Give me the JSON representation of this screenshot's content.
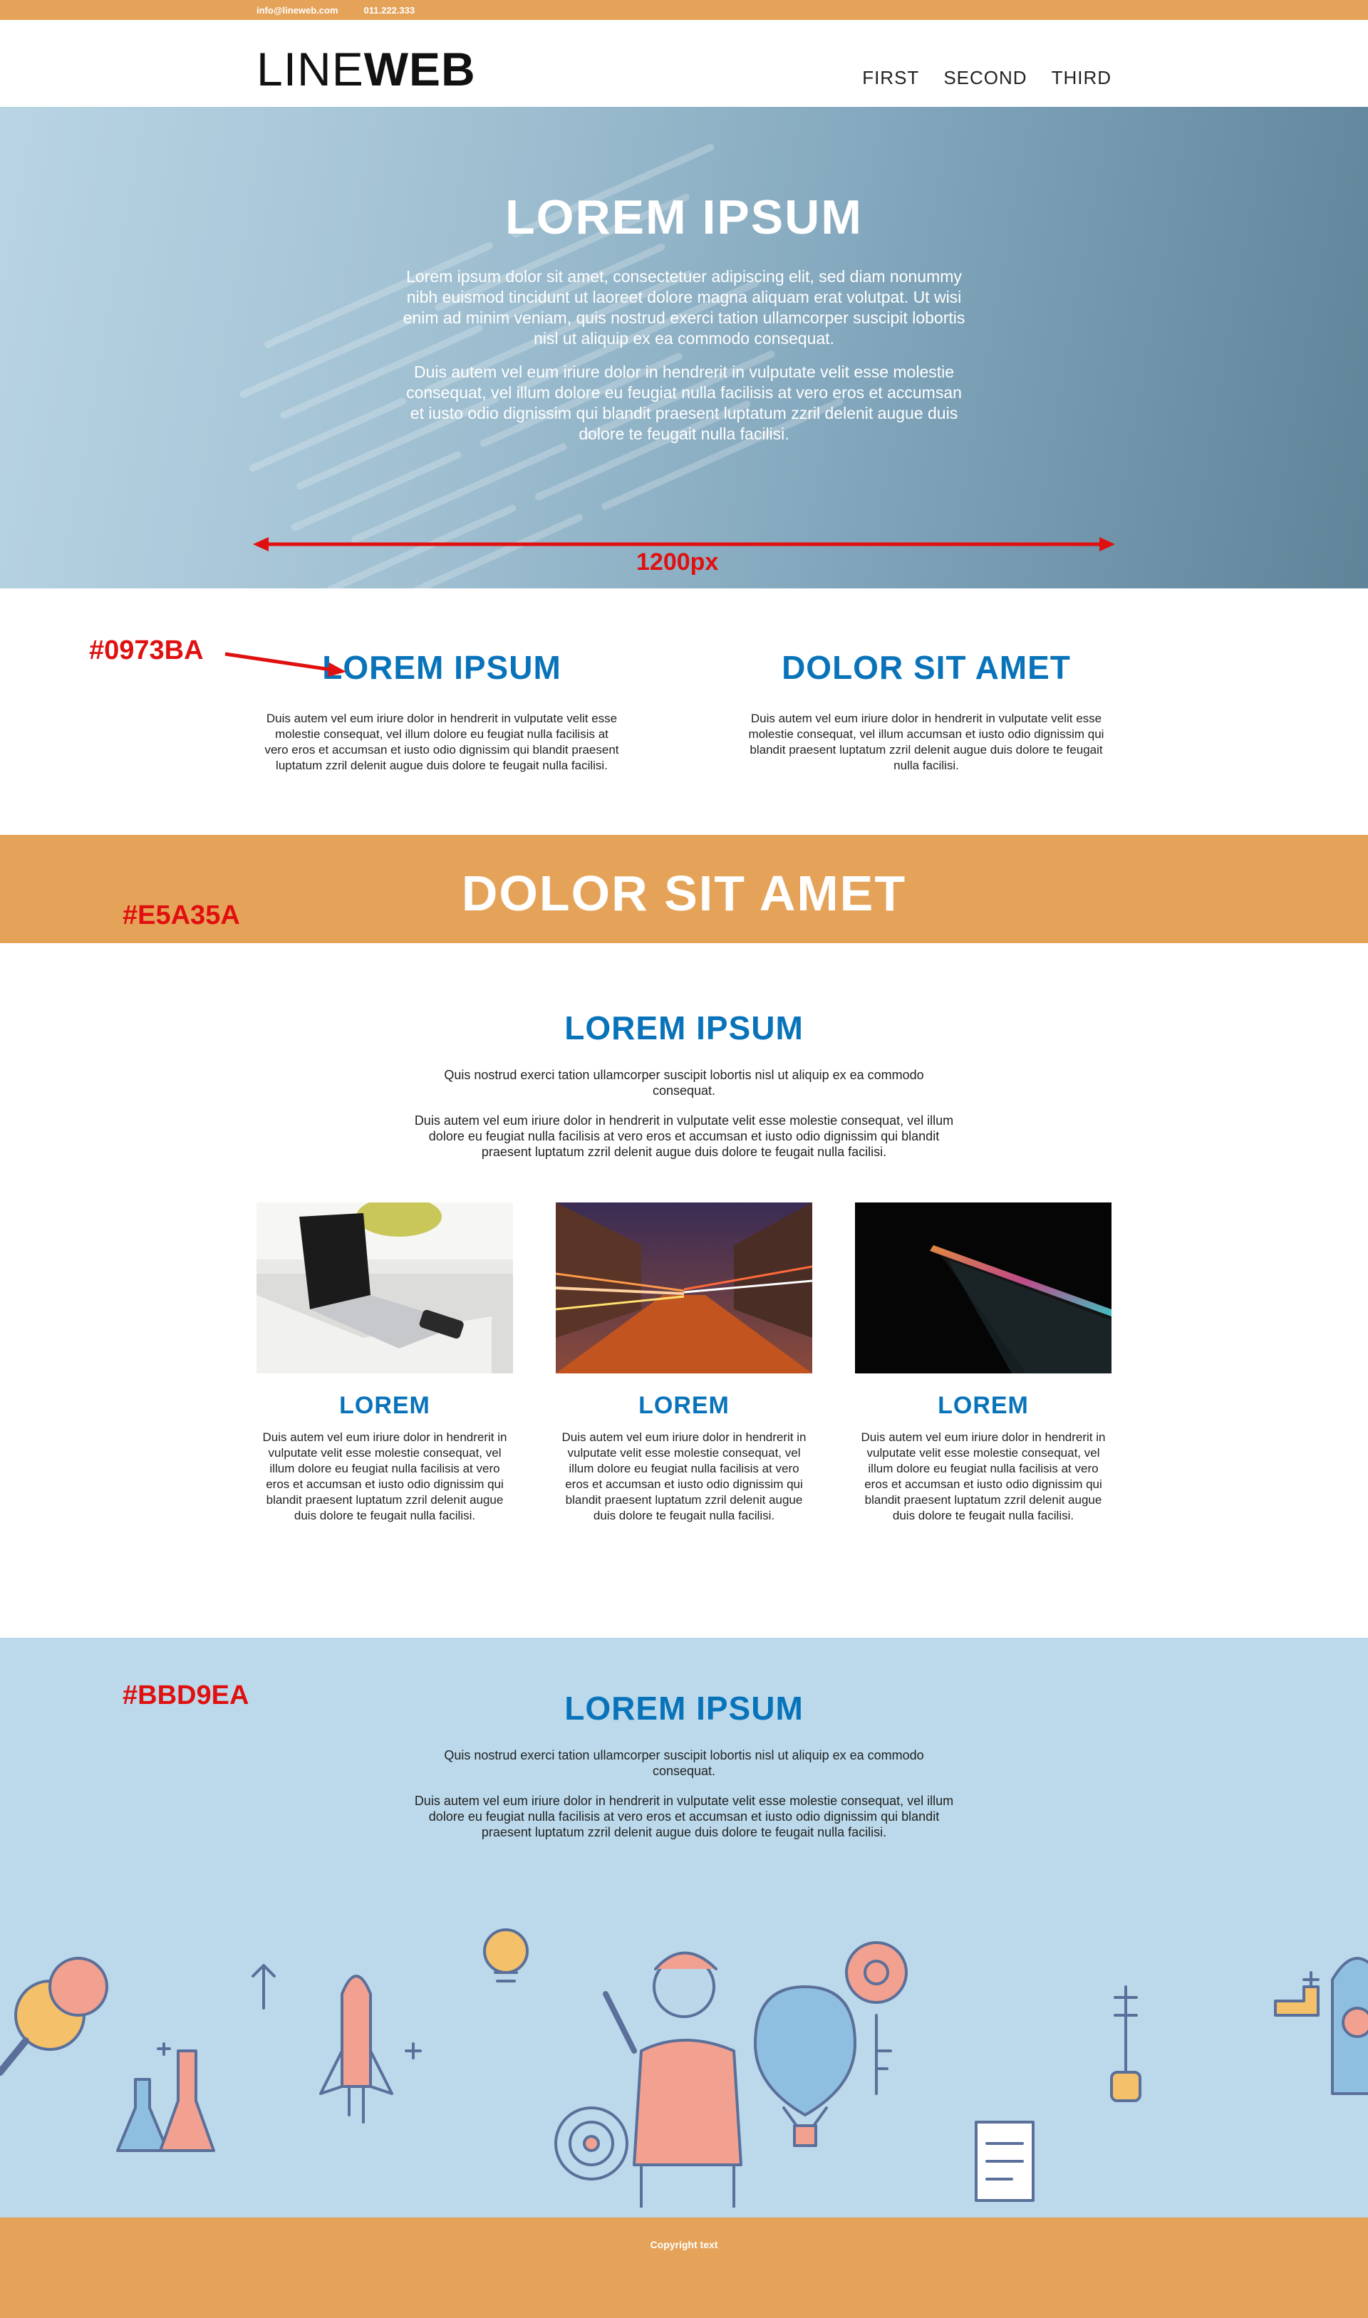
{
  "topbar": {
    "email": "info@lineweb.com",
    "phone": "011.222.333"
  },
  "logo": {
    "light": "LINE",
    "bold": "WEB"
  },
  "nav": [
    {
      "label": "FIRST"
    },
    {
      "label": "SECOND"
    },
    {
      "label": "THIRD"
    }
  ],
  "hero": {
    "title": "LOREM IPSUM",
    "para1": "Lorem ipsum dolor sit amet, consectetuer adipiscing elit, sed diam nonummy nibh euismod tincidunt ut laoreet dolore magna aliquam erat volutpat. Ut wisi enim ad minim veniam, quis nostrud exerci tation ullamcorper suscipit lobortis nisl ut aliquip ex ea commodo consequat.",
    "para2": "Duis autem vel eum iriure dolor in hendrerit in vulputate velit esse molestie consequat, vel illum dolore eu feugiat nulla facilisis at vero eros et accumsan et iusto odio dignissim qui blandit praesent luptatum zzril delenit augue duis dolore te feugait nulla facilisi.",
    "measure_label": "1200px"
  },
  "annotations": {
    "blue": "#0973BA",
    "orange": "#E5A35A",
    "light": "#BBD9EA"
  },
  "two_col": [
    {
      "title": "LOREM IPSUM",
      "text": "Duis autem vel eum iriure dolor in hendrerit in vulputate velit esse molestie consequat, vel illum dolore eu feugiat nulla facilisis at vero eros et accumsan et iusto odio dignissim qui blandit praesent luptatum zzril delenit augue duis dolore te feugait nulla facilisi."
    },
    {
      "title": "DOLOR SIT AMET",
      "text": "Duis autem vel eum iriure dolor in hendrerit in vulputate velit esse molestie consequat, vel illum accumsan et iusto odio dignissim qui blandit praesent luptatum zzril delenit augue duis dolore te feugait nulla facilisi."
    }
  ],
  "banner": {
    "title": "DOLOR SIT AMET"
  },
  "features": {
    "title": "LOREM IPSUM",
    "lead1": "Quis nostrud exerci tation ullamcorper suscipit lobortis nisl ut aliquip ex ea commodo consequat.",
    "lead2": "Duis autem vel eum iriure dolor in hendrerit in vulputate velit esse molestie consequat, vel illum dolore eu feugiat nulla facilisis at vero eros et accumsan et iusto odio dignissim qui blandit praesent luptatum zzril delenit augue duis dolore te feugait nulla facilisi.",
    "cards": [
      {
        "image": "laptop-photo",
        "title": "LOREM",
        "text": "Duis autem vel eum iriure dolor in hendrerit in vulputate velit esse molestie consequat, vel illum dolore eu feugiat nulla facilisis at vero eros et accumsan et iusto odio dignissim qui blandit praesent luptatum zzril delenit augue duis dolore te feugait nulla facilisi."
      },
      {
        "image": "city-lights-photo",
        "title": "LOREM",
        "text": "Duis autem vel eum iriure dolor in hendrerit in vulputate velit esse molestie consequat, vel illum dolore eu feugiat nulla facilisis at vero eros et accumsan et iusto odio dignissim qui blandit praesent luptatum zzril delenit augue duis dolore te feugait nulla facilisi."
      },
      {
        "image": "dark-laptop-photo",
        "title": "LOREM",
        "text": "Duis autem vel eum iriure dolor in hendrerit in vulputate velit esse molestie consequat, vel illum dolore eu feugiat nulla facilisis at vero eros et accumsan et iusto odio dignissim qui blandit praesent luptatum zzril delenit augue duis dolore te feugait nulla facilisi."
      }
    ]
  },
  "blue_section": {
    "title": "LOREM IPSUM",
    "lead1": "Quis nostrud exerci tation ullamcorper suscipit lobortis nisl ut aliquip ex ea commodo consequat.",
    "lead2": "Duis autem vel eum iriure dolor in hendrerit in vulputate velit esse molestie consequat, vel illum dolore eu feugiat nulla facilisis at vero eros et accumsan et iusto odio dignissim qui blandit praesent luptatum zzril delenit augue duis dolore te feugait nulla facilisi."
  },
  "footer": {
    "copyright": "Copyright text"
  },
  "colors": {
    "primary": "#0973BA",
    "accent": "#E5A35A",
    "light": "#BBD9EA",
    "annotation": "#e01010"
  }
}
